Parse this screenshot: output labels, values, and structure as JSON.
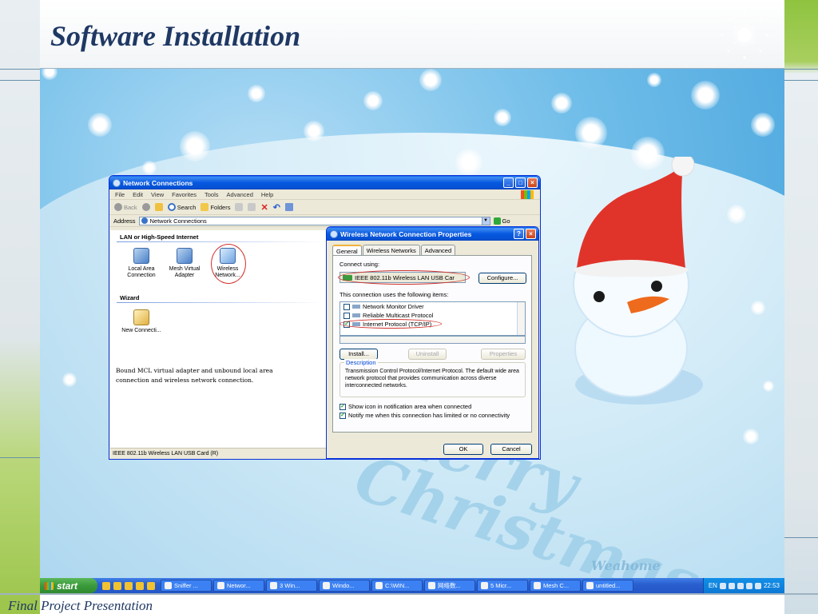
{
  "slide": {
    "title": "Software Installation",
    "footer": "Final Project Presentation"
  },
  "desktop": {
    "greeting_art": "Merry Christmas",
    "greeting_signature": "Weahome"
  },
  "network_window": {
    "title": "Network Connections",
    "menu": [
      "File",
      "Edit",
      "View",
      "Favorites",
      "Tools",
      "Advanced",
      "Help"
    ],
    "toolbar": {
      "back": "Back",
      "search": "Search",
      "folders": "Folders"
    },
    "address_label": "Address",
    "address_value": "Network Connections",
    "go_label": "Go",
    "group_lan": "LAN or High-Speed Internet",
    "group_wizard": "Wizard",
    "connections": [
      {
        "label": "Local Area Connection"
      },
      {
        "label": "Mesh Virtual Adapter"
      },
      {
        "label": "Wireless Network..."
      }
    ],
    "wizard_item": "New Connecti...",
    "note": "Bound MCL virtual adapter and unbound local area connection and wireless network connection.",
    "status": "IEEE 802.11b Wireless LAN USB Card (R)"
  },
  "properties_dialog": {
    "title": "Wireless Network Connection Properties",
    "tabs": [
      "General",
      "Wireless Networks",
      "Advanced"
    ],
    "connect_using_label": "Connect using:",
    "adapter_name": "IEEE 802.11b Wireless LAN USB Car",
    "configure_button": "Configure...",
    "items_label": "This connection uses the following items:",
    "items": [
      {
        "label": "Network Monitor Driver",
        "checked": false
      },
      {
        "label": "Reliable Multicast Protocol",
        "checked": false
      },
      {
        "label": "Internet Protocol (TCP/IP)",
        "checked": true
      }
    ],
    "install_button": "Install...",
    "uninstall_button": "Uninstall",
    "properties_button": "Properties",
    "description_title": "Description",
    "description_text": "Transmission Control Protocol/Internet Protocol. The default wide area network protocol that provides communication across diverse interconnected networks.",
    "show_icon_label": "Show icon in notification area when connected",
    "notify_label": "Notify me when this connection has limited or no connectivity",
    "ok_button": "OK",
    "cancel_button": "Cancel"
  },
  "taskbar": {
    "start_label": "start",
    "tasks": [
      "Sniffer ...",
      "Networ...",
      "3 Win...",
      "Windo...",
      "C:\\WIN...",
      "网络数...",
      "5 Micr...",
      "Mesh C...",
      "untitled..."
    ],
    "language": "EN",
    "clock": "22:53"
  },
  "colors": {
    "title_text": "#1f3864",
    "xp_titlebar": "#0758e0",
    "highlight_ring": "#d0302a"
  }
}
